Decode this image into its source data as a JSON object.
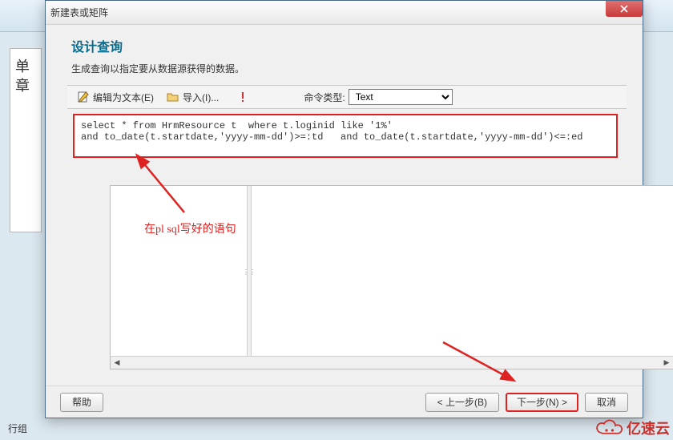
{
  "bg": {
    "left_char1": "单",
    "left_char2": "章",
    "bottom_label": "行组"
  },
  "dialog": {
    "title": "新建表或矩阵",
    "heading": "设计查询",
    "desc": "生成查询以指定要从数据源获得的数据。",
    "toolbar": {
      "edit_as_text": "编辑为文本(E)",
      "import": "导入(I)...",
      "cmd_type_label": "命令类型:",
      "cmd_type_value": "Text"
    },
    "sql_line1": "select * from HrmResource t  where t.loginid like '1%'",
    "sql_line2": "and to_date(t.startdate,'yyyy-mm-dd')>=:td   and to_date(t.startdate,'yyyy-mm-dd')<=:ed",
    "annotation": "在pl sql写好的语句",
    "buttons": {
      "help": "帮助",
      "prev": "< 上一步(B)",
      "next": "下一步(N) >",
      "cancel": "取消"
    }
  },
  "watermark_text": "亿速云"
}
